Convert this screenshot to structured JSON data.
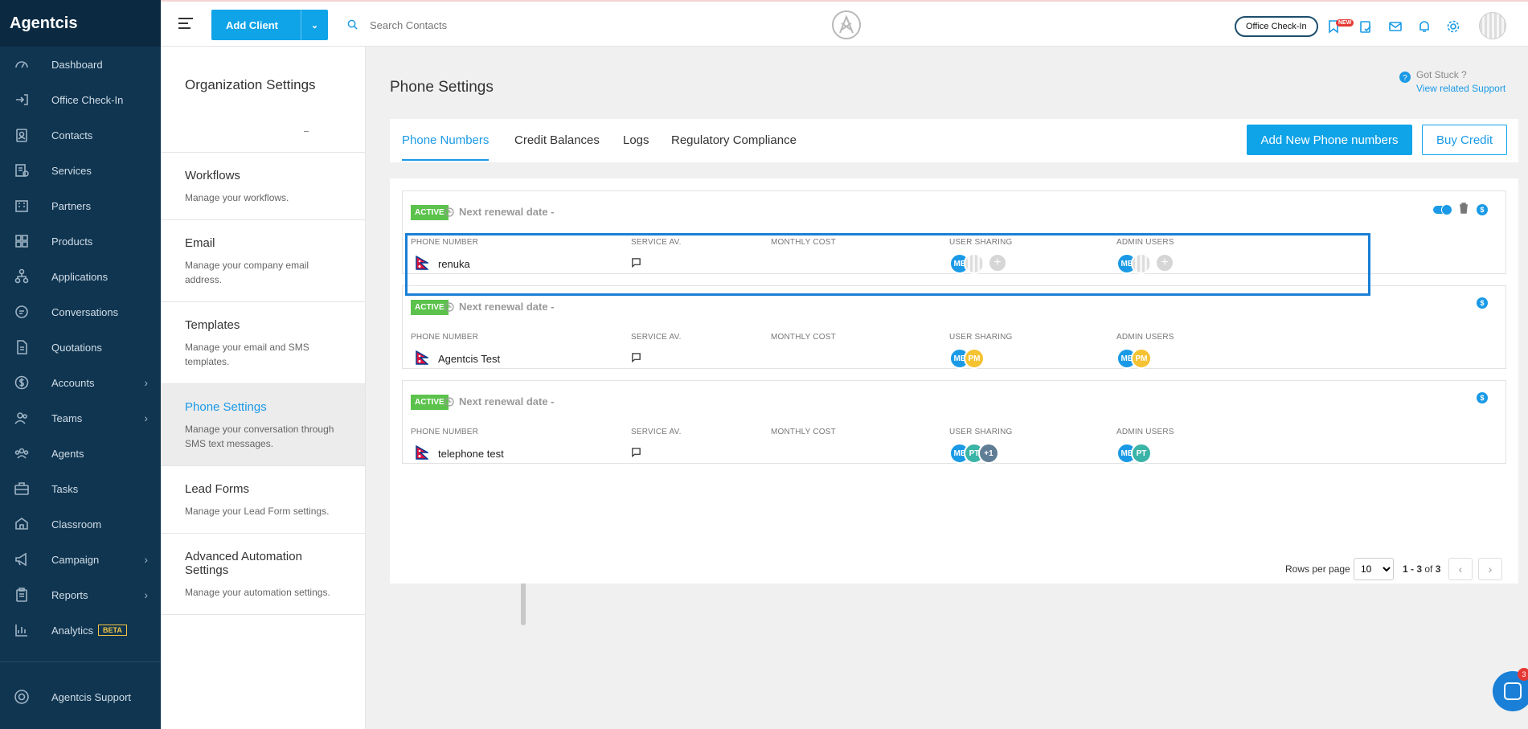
{
  "brand": "Agentcis",
  "nav": {
    "items": [
      {
        "label": "Dashboard",
        "icon": "gauge-icon"
      },
      {
        "label": "Office Check-In",
        "icon": "checkin-icon"
      },
      {
        "label": "Contacts",
        "icon": "contacts-icon"
      },
      {
        "label": "Services",
        "icon": "services-icon"
      },
      {
        "label": "Partners",
        "icon": "building-icon"
      },
      {
        "label": "Products",
        "icon": "grid-icon"
      },
      {
        "label": "Applications",
        "icon": "flow-icon"
      },
      {
        "label": "Conversations",
        "icon": "chat-icon"
      },
      {
        "label": "Quotations",
        "icon": "document-icon"
      },
      {
        "label": "Accounts",
        "icon": "dollar-icon",
        "has_children": true
      },
      {
        "label": "Teams",
        "icon": "team-icon",
        "has_children": true
      },
      {
        "label": "Agents",
        "icon": "agents-icon"
      },
      {
        "label": "Tasks",
        "icon": "briefcase-icon"
      },
      {
        "label": "Classroom",
        "icon": "classroom-icon"
      },
      {
        "label": "Campaign",
        "icon": "megaphone-icon",
        "has_children": true
      },
      {
        "label": "Reports",
        "icon": "clipboard-icon",
        "has_children": true
      },
      {
        "label": "Analytics",
        "icon": "analytics-icon",
        "badge": "BETA"
      }
    ],
    "support": "Agentcis Support"
  },
  "topbar": {
    "add_client": "Add Client",
    "search_placeholder": "Search Contacts",
    "office_checkin": "Office Check-In",
    "new_badge": "NEW"
  },
  "settings": {
    "title": "Organization Settings",
    "items": [
      {
        "title": "Workflows",
        "desc": "Manage your workflows."
      },
      {
        "title": "Email",
        "desc": "Manage your company email address."
      },
      {
        "title": "Templates",
        "desc": "Manage your email and SMS templates."
      },
      {
        "title": "Phone Settings",
        "desc": "Manage your conversation through SMS text messages.",
        "active": true
      },
      {
        "title": "Lead Forms",
        "desc": "Manage your Lead Form settings."
      },
      {
        "title": "Advanced Automation Settings",
        "desc": "Manage your automation settings."
      }
    ]
  },
  "page": {
    "title": "Phone Settings",
    "help_line1": "Got Stuck ?",
    "help_line2": "View related Support"
  },
  "tabs": [
    {
      "label": "Phone Numbers",
      "active": true
    },
    {
      "label": "Credit Balances"
    },
    {
      "label": "Logs"
    },
    {
      "label": "Regulatory Compliance"
    }
  ],
  "actions": {
    "add_phone": "Add New Phone numbers",
    "buy_credit": "Buy Credit"
  },
  "columns": {
    "phone": "PHONE NUMBER",
    "service": "SERVICE AV.",
    "cost": "MONTHLY COST",
    "sharing": "USER SHARING",
    "admins": "ADMIN USERS"
  },
  "phone_numbers": [
    {
      "status": "ACTIVE",
      "renewal": "Next renewal date -",
      "name": "renuka",
      "user_sharing": [
        "ME",
        "",
        "+"
      ],
      "admin_users": [
        "ME",
        "",
        "+"
      ]
    },
    {
      "status": "ACTIVE",
      "renewal": "Next renewal date -",
      "name": "Agentcis Test",
      "user_sharing": [
        "ME",
        "PM"
      ],
      "admin_users": [
        "ME",
        "PM"
      ]
    },
    {
      "status": "ACTIVE",
      "renewal": "Next renewal date -",
      "name": "telephone test",
      "user_sharing": [
        "ME",
        "PT",
        "+1"
      ],
      "admin_users": [
        "ME",
        "PT"
      ]
    }
  ],
  "pagination": {
    "rows_label": "Rows per page",
    "rows_value": "10",
    "range": "1 - 3",
    "of": "of",
    "total": "3"
  },
  "chat_widget_count": "3",
  "colors": {
    "primary": "#0fa3e8",
    "nav_bg": "#0f3551",
    "active_badge": "#5bc24b"
  }
}
